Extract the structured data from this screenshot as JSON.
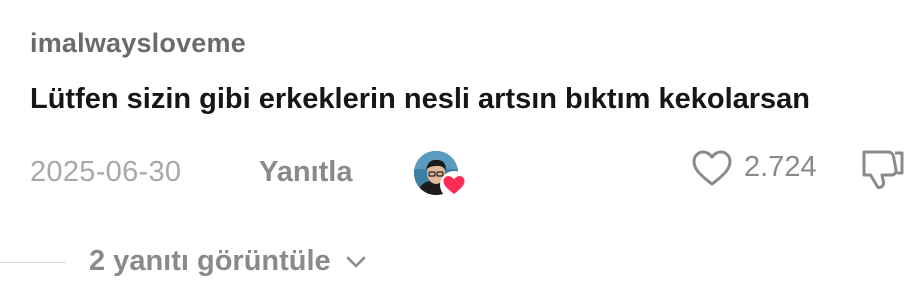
{
  "comment": {
    "username": "imalwaysloveme",
    "text": "Lütfen sizin gibi erkeklerin nesli artsın bıktım kekolarsan",
    "date": "2025-06-30",
    "reply_label": "Yanıtla",
    "like_count": "2.724",
    "creator_liked": true,
    "icons": {
      "like": "heart-outline-icon",
      "dislike": "thumbs-down-icon",
      "creator_heart": "heart-filled-icon",
      "expand": "chevron-down-icon"
    },
    "colors": {
      "heart_badge": "#fe2c55",
      "muted_text": "#8a8a8a",
      "date_text": "#a8a8a8",
      "body_text": "#161616"
    }
  },
  "replies": {
    "view_label": "2 yanıtı görüntüle"
  }
}
